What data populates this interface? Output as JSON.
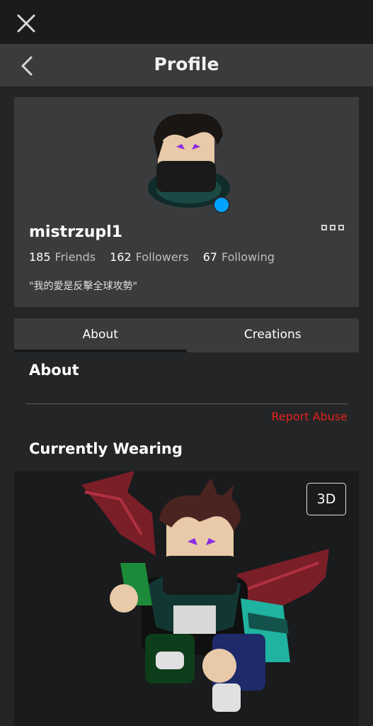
{
  "header": {
    "title": "Profile",
    "close_icon": "close-icon",
    "back_icon": "chevron-left-icon"
  },
  "profile": {
    "username": "mistrzupl1",
    "online": true,
    "online_color": "#00a2ff",
    "status": "\"我的愛是反擊全球攻勢\"",
    "stats": {
      "friends_count": "185",
      "friends_label": "Friends",
      "followers_count": "162",
      "followers_label": "Followers",
      "following_count": "67",
      "following_label": "Following"
    }
  },
  "tabs": [
    {
      "label": "About",
      "active": true
    },
    {
      "label": "Creations",
      "active": false
    }
  ],
  "about": {
    "title": "About",
    "report_label": "Report Abuse",
    "report_color": "#e2231a"
  },
  "wearing": {
    "title": "Currently Wearing",
    "btn_3d": "3D"
  }
}
